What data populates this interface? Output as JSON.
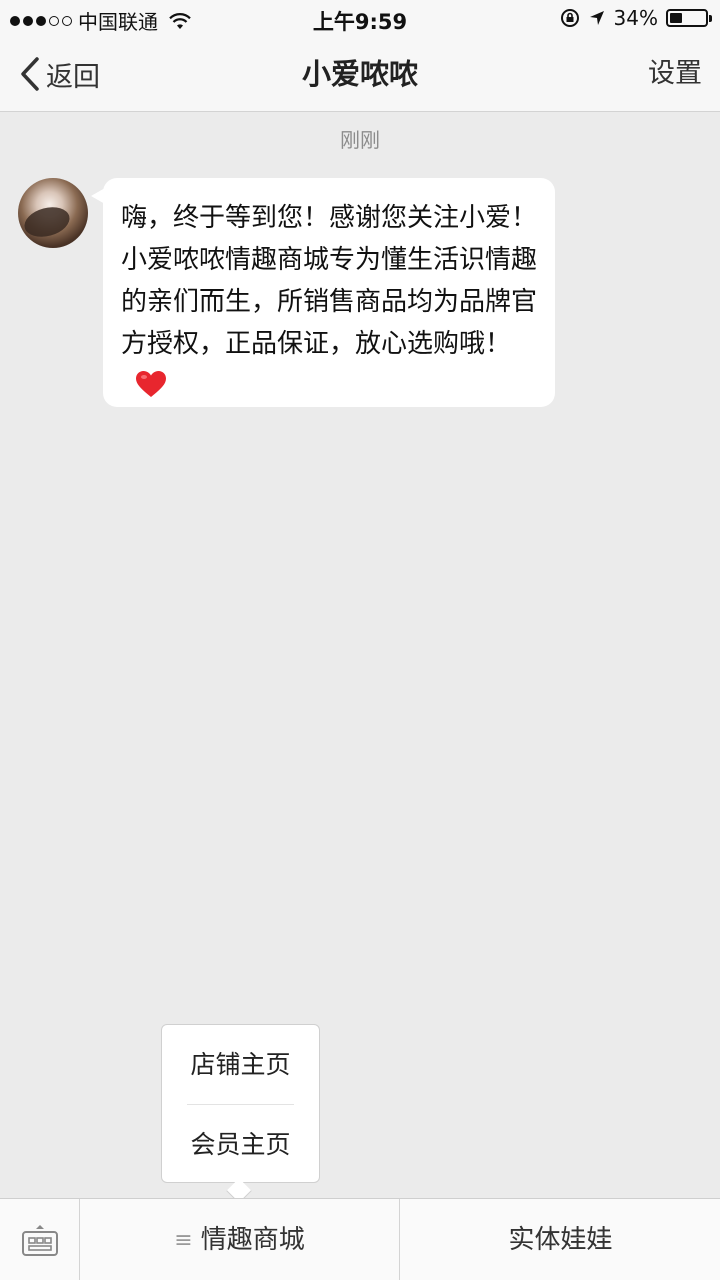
{
  "status_bar": {
    "carrier": "中国联通",
    "time": "上午9:59",
    "battery": "34%",
    "battery_level": 0.34,
    "signal_dots_filled": 3,
    "signal_dots_total": 5
  },
  "nav": {
    "back_label": "返回",
    "title": "小爱哝哝",
    "settings_label": "设置"
  },
  "chat": {
    "timestamp": "刚刚",
    "message": "嗨，终于等到您！感谢您关注小爱！小爱哝哝情趣商城专为懂生活识情趣的亲们而生，所销售商品均为品牌官方授权，正品保证，放心选购哦！"
  },
  "popup": {
    "items": [
      {
        "label": "店铺主页"
      },
      {
        "label": "会员主页"
      }
    ]
  },
  "bottom_menu": {
    "mall_label": "情趣商城",
    "doll_label": "实体娃娃"
  },
  "colors": {
    "background": "#ebebeb",
    "bubble": "#ffffff",
    "heart": "#e8262e"
  }
}
